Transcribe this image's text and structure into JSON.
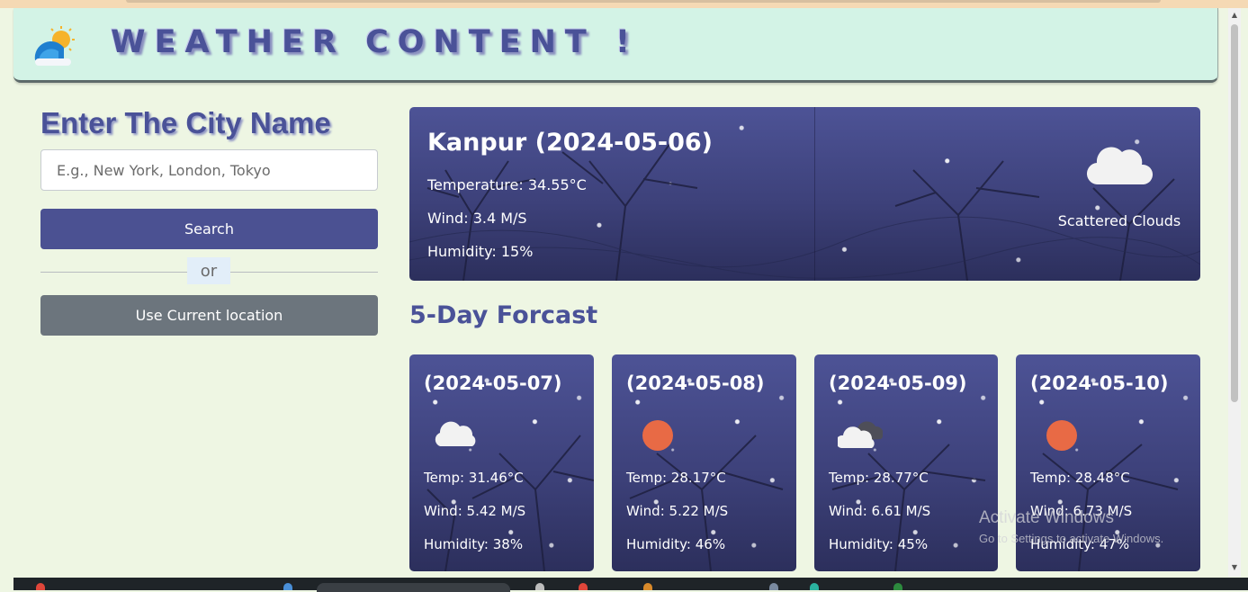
{
  "app": {
    "title": "WEATHER CONTENT !"
  },
  "search": {
    "heading": "Enter The City Name",
    "placeholder": "E.g., New York, London, Tokyo",
    "search_button": "Search",
    "divider_text": "or",
    "location_button": "Use Current location"
  },
  "current": {
    "city_date": "Kanpur (2024-05-06)",
    "temperature": "Temperature: 34.55°C",
    "wind": "Wind: 3.4 M/S",
    "humidity": "Humidity: 15%",
    "description": "Scattered Clouds",
    "icon": "scattered-clouds-icon"
  },
  "forecast": {
    "title": "5-Day Forcast",
    "days": [
      {
        "date": "(2024-05-07)",
        "temp": "Temp: 31.46°C",
        "wind": "Wind: 5.42 M/S",
        "humidity": "Humidity: 38%",
        "icon": "cloud-icon"
      },
      {
        "date": "(2024-05-08)",
        "temp": "Temp: 28.17°C",
        "wind": "Wind: 5.22 M/S",
        "humidity": "Humidity: 46%",
        "icon": "sun-icon"
      },
      {
        "date": "(2024-05-09)",
        "temp": "Temp: 28.77°C",
        "wind": "Wind: 6.61 M/S",
        "humidity": "Humidity: 45%",
        "icon": "broken-clouds-icon"
      },
      {
        "date": "(2024-05-10)",
        "temp": "Temp: 28.48°C",
        "wind": "Wind: 6.73 M/S",
        "humidity": "Humidity: 47%",
        "icon": "sun-icon"
      }
    ]
  },
  "watermark": {
    "title": "Activate Windows",
    "subtitle": "Go to Settings to activate Windows."
  },
  "colors": {
    "accent": "#4b5192",
    "header_bg": "#d3f3e6",
    "page_bg": "#eef6e3",
    "location_button": "#6c757d",
    "sun": "#e86a45"
  }
}
